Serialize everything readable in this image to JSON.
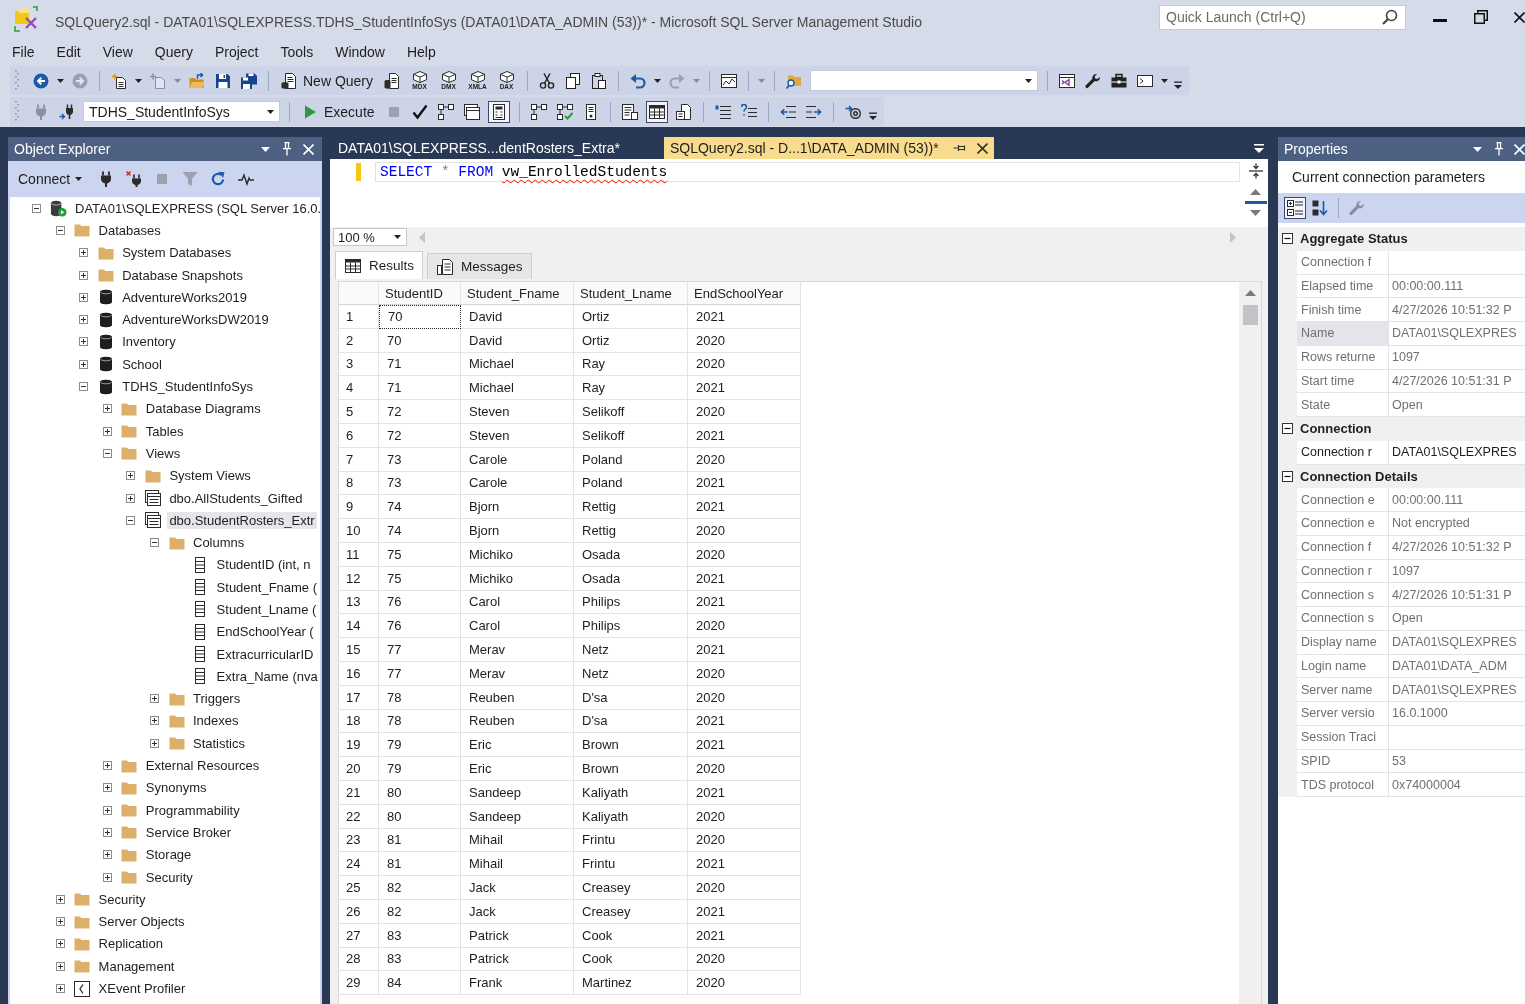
{
  "window": {
    "title": "SQLQuery2.sql - DATA01\\SQLEXPRESS.TDHS_StudentInfoSys (DATA01\\DATA_ADMIN (53))* - Microsoft SQL Server Management Studio",
    "quick_launch": {
      "placeholder": "Quick Launch (Ctrl+Q)"
    }
  },
  "menu": [
    "File",
    "Edit",
    "View",
    "Query",
    "Project",
    "Tools",
    "Window",
    "Help"
  ],
  "toolbars": [
    {
      "items": [
        {
          "kind": "grip"
        },
        {
          "kind": "icon",
          "disabled": false,
          "pressed": false
        },
        {
          "kind": "caret",
          "disabled": false
        },
        {
          "kind": "icon",
          "disabled": true,
          "pressed": false
        },
        {
          "kind": "separator"
        },
        {
          "kind": "icon",
          "disabled": false,
          "pressed": false
        },
        {
          "kind": "caret",
          "disabled": false
        },
        {
          "kind": "icon",
          "disabled": true,
          "pressed": false
        },
        {
          "kind": "caret",
          "disabled": true
        },
        {
          "kind": "icon",
          "disabled": false,
          "pressed": false
        },
        {
          "kind": "icon",
          "disabled": false,
          "pressed": false
        },
        {
          "kind": "icon",
          "disabled": false,
          "pressed": false
        },
        {
          "kind": "separator"
        },
        {
          "kind": "labeled",
          "label": "New Query",
          "disabled": false
        },
        {
          "kind": "icon",
          "disabled": false,
          "pressed": false
        },
        {
          "kind": "cube",
          "label": "MDX"
        },
        {
          "kind": "cube",
          "label": "DMX"
        },
        {
          "kind": "cube",
          "label": "XMLA"
        },
        {
          "kind": "cube",
          "label": "DAX"
        },
        {
          "kind": "separator"
        },
        {
          "kind": "icon",
          "disabled": false,
          "pressed": false
        },
        {
          "kind": "icon",
          "disabled": false,
          "pressed": false
        },
        {
          "kind": "icon",
          "disabled": false,
          "pressed": false
        },
        {
          "kind": "separator"
        },
        {
          "kind": "icon",
          "disabled": false,
          "pressed": false
        },
        {
          "kind": "caret",
          "disabled": false
        },
        {
          "kind": "icon",
          "disabled": true,
          "pressed": false
        },
        {
          "kind": "caret",
          "disabled": true
        },
        {
          "kind": "separator"
        },
        {
          "kind": "icon",
          "disabled": false,
          "pressed": false
        },
        {
          "kind": "separator"
        },
        {
          "kind": "caret",
          "disabled": true
        },
        {
          "kind": "separator"
        },
        {
          "kind": "icon",
          "disabled": false,
          "pressed": false
        },
        {
          "kind": "combo"
        },
        {
          "kind": "separator"
        },
        {
          "kind": "icon",
          "disabled": false,
          "pressed": false
        },
        {
          "kind": "icon",
          "disabled": false,
          "pressed": false
        },
        {
          "kind": "icon",
          "disabled": false,
          "pressed": false
        },
        {
          "kind": "icon",
          "disabled": false,
          "pressed": false
        },
        {
          "kind": "caret",
          "disabled": false
        },
        {
          "kind": "overflow"
        }
      ]
    },
    {
      "items": [
        {
          "kind": "grip"
        },
        {
          "kind": "icon",
          "disabled": true,
          "pressed": false
        },
        {
          "kind": "icon",
          "disabled": false,
          "pressed": false
        },
        {
          "kind": "combo",
          "value": "TDHS_StudentInfoSys"
        },
        {
          "kind": "separator"
        },
        {
          "kind": "labeled",
          "label": "Execute",
          "disabled": false
        },
        {
          "kind": "icon",
          "disabled": true,
          "pressed": false
        },
        {
          "kind": "icon",
          "disabled": false,
          "pressed": false
        },
        {
          "kind": "icon",
          "disabled": false,
          "pressed": false
        },
        {
          "kind": "icon",
          "disabled": false,
          "pressed": false
        },
        {
          "kind": "icon",
          "disabled": false,
          "pressed": true
        },
        {
          "kind": "separator"
        },
        {
          "kind": "icon",
          "disabled": false,
          "pressed": false
        },
        {
          "kind": "icon",
          "disabled": false,
          "pressed": false
        },
        {
          "kind": "icon",
          "disabled": false,
          "pressed": false
        },
        {
          "kind": "separator"
        },
        {
          "kind": "icon",
          "disabled": false,
          "pressed": false
        },
        {
          "kind": "icon",
          "disabled": false,
          "pressed": true
        },
        {
          "kind": "icon",
          "disabled": false,
          "pressed": false
        },
        {
          "kind": "separator"
        },
        {
          "kind": "icon",
          "disabled": false,
          "pressed": false
        },
        {
          "kind": "icon",
          "disabled": false,
          "pressed": false
        },
        {
          "kind": "separator"
        },
        {
          "kind": "icon",
          "disabled": false,
          "pressed": false
        },
        {
          "kind": "icon",
          "disabled": false,
          "pressed": false
        },
        {
          "kind": "separator"
        },
        {
          "kind": "icon",
          "disabled": false,
          "pressed": false
        },
        {
          "kind": "overflow"
        }
      ]
    }
  ],
  "object_explorer": {
    "title": "Object Explorer",
    "toolbar": [
      {
        "kind": "dropdown",
        "label": "Connect"
      },
      {
        "kind": "icon",
        "disabled": false,
        "pressed": false
      },
      {
        "kind": "icon",
        "disabled": false,
        "pressed": false
      },
      {
        "kind": "icon",
        "disabled": true,
        "pressed": false
      },
      {
        "kind": "icon",
        "disabled": true,
        "pressed": false
      },
      {
        "kind": "icon",
        "disabled": false,
        "pressed": false
      },
      {
        "kind": "icon",
        "disabled": false,
        "pressed": false
      }
    ],
    "tree": [
      {
        "label": "DATA01\\SQLEXPRESS (SQL Server 16.0.",
        "kind": "server",
        "expanded": true,
        "selected": false,
        "children": [
          {
            "label": "Databases",
            "kind": "folder",
            "expanded": true,
            "selected": false,
            "children": [
              {
                "label": "System Databases",
                "kind": "folder",
                "expanded": false,
                "selected": false
              },
              {
                "label": "Database Snapshots",
                "kind": "folder",
                "expanded": false,
                "selected": false
              },
              {
                "label": "AdventureWorks2019",
                "kind": "database",
                "expanded": false,
                "selected": false
              },
              {
                "label": "AdventureWorksDW2019",
                "kind": "database",
                "expanded": false,
                "selected": false
              },
              {
                "label": "Inventory",
                "kind": "database",
                "expanded": false,
                "selected": false
              },
              {
                "label": "School",
                "kind": "database",
                "expanded": false,
                "selected": false
              },
              {
                "label": "TDHS_StudentInfoSys",
                "kind": "database",
                "expanded": true,
                "selected": false,
                "children": [
                  {
                    "label": "Database Diagrams",
                    "kind": "folder",
                    "expanded": false,
                    "selected": false
                  },
                  {
                    "label": "Tables",
                    "kind": "folder",
                    "expanded": false,
                    "selected": false
                  },
                  {
                    "label": "Views",
                    "kind": "folder",
                    "expanded": true,
                    "selected": false,
                    "children": [
                      {
                        "label": "System Views",
                        "kind": "folder",
                        "expanded": false,
                        "selected": false
                      },
                      {
                        "label": "dbo.AllStudents_Gifted",
                        "kind": "view",
                        "expanded": false,
                        "selected": false
                      },
                      {
                        "label": "dbo.StudentRosters_Extr",
                        "kind": "view",
                        "expanded": true,
                        "selected": true,
                        "children": [
                          {
                            "label": "Columns",
                            "kind": "folder",
                            "expanded": true,
                            "selected": false,
                            "children": [
                              {
                                "label": "StudentID (int, n",
                                "kind": "column",
                                "selected": false
                              },
                              {
                                "label": "Student_Fname (",
                                "kind": "column",
                                "selected": false
                              },
                              {
                                "label": "Student_Lname (",
                                "kind": "column",
                                "selected": false
                              },
                              {
                                "label": "EndSchoolYear (",
                                "kind": "column",
                                "selected": false
                              },
                              {
                                "label": "ExtracurricularID",
                                "kind": "column",
                                "selected": false
                              },
                              {
                                "label": "Extra_Name (nva",
                                "kind": "column",
                                "selected": false
                              }
                            ]
                          },
                          {
                            "label": "Triggers",
                            "kind": "folder",
                            "expanded": false,
                            "selected": false
                          },
                          {
                            "label": "Indexes",
                            "kind": "folder",
                            "expanded": false,
                            "selected": false
                          },
                          {
                            "label": "Statistics",
                            "kind": "folder",
                            "expanded": false,
                            "selected": false
                          }
                        ]
                      }
                    ]
                  },
                  {
                    "label": "External Resources",
                    "kind": "folder",
                    "expanded": false,
                    "selected": false
                  },
                  {
                    "label": "Synonyms",
                    "kind": "folder",
                    "expanded": false,
                    "selected": false
                  },
                  {
                    "label": "Programmability",
                    "kind": "folder",
                    "expanded": false,
                    "selected": false
                  },
                  {
                    "label": "Service Broker",
                    "kind": "folder",
                    "expanded": false,
                    "selected": false
                  },
                  {
                    "label": "Storage",
                    "kind": "folder",
                    "expanded": false,
                    "selected": false
                  },
                  {
                    "label": "Security",
                    "kind": "folder",
                    "expanded": false,
                    "selected": false
                  }
                ]
              }
            ]
          },
          {
            "label": "Security",
            "kind": "folder",
            "expanded": false,
            "selected": false
          },
          {
            "label": "Server Objects",
            "kind": "folder",
            "expanded": false,
            "selected": false
          },
          {
            "label": "Replication",
            "kind": "folder",
            "expanded": false,
            "selected": false
          },
          {
            "label": "Management",
            "kind": "folder",
            "expanded": false,
            "selected": false
          },
          {
            "label": "XEvent Profiler",
            "kind": "profiler",
            "expanded": false,
            "selected": false
          }
        ]
      }
    ]
  },
  "editor": {
    "tabs": [
      {
        "label": "DATA01\\SQLEXPRESS...dentRosters_Extra*",
        "selected": false
      },
      {
        "label": "SQLQuery2.sql - D...1\\DATA_ADMIN (53))*",
        "selected": true
      }
    ],
    "code_lines": [
      [
        {
          "kind": "keyword",
          "text": "SELECT",
          "error": false
        },
        {
          "kind": "operator",
          "text": "*",
          "error": false
        },
        {
          "kind": "keyword",
          "text": "FROM",
          "error": false
        },
        {
          "kind": "identifier",
          "text": "vw_EnrolledStudents",
          "error": true
        }
      ]
    ],
    "zoom": "100 %"
  },
  "results": {
    "tabs": [
      {
        "label": "Results",
        "selected": true
      },
      {
        "label": "Messages",
        "selected": false
      }
    ],
    "columns": [
      "StudentID",
      "Student_Fname",
      "Student_Lname",
      "EndSchoolYear"
    ],
    "rows": [
      {
        "number": "1",
        "cells": [
          "70",
          "David",
          "Ortiz",
          "2021"
        ],
        "focused": true
      },
      {
        "number": "2",
        "cells": [
          "70",
          "David",
          "Ortiz",
          "2020"
        ],
        "focused": false
      },
      {
        "number": "3",
        "cells": [
          "71",
          "Michael",
          "Ray",
          "2020"
        ],
        "focused": false
      },
      {
        "number": "4",
        "cells": [
          "71",
          "Michael",
          "Ray",
          "2021"
        ],
        "focused": false
      },
      {
        "number": "5",
        "cells": [
          "72",
          "Steven",
          "Selikoff",
          "2020"
        ],
        "focused": false
      },
      {
        "number": "6",
        "cells": [
          "72",
          "Steven",
          "Selikoff",
          "2021"
        ],
        "focused": false
      },
      {
        "number": "7",
        "cells": [
          "73",
          "Carole",
          "Poland",
          "2020"
        ],
        "focused": false
      },
      {
        "number": "8",
        "cells": [
          "73",
          "Carole",
          "Poland",
          "2021"
        ],
        "focused": false
      },
      {
        "number": "9",
        "cells": [
          "74",
          "Bjorn",
          "Rettig",
          "2021"
        ],
        "focused": false
      },
      {
        "number": "10",
        "cells": [
          "74",
          "Bjorn",
          "Rettig",
          "2020"
        ],
        "focused": false
      },
      {
        "number": "11",
        "cells": [
          "75",
          "Michiko",
          "Osada",
          "2020"
        ],
        "focused": false
      },
      {
        "number": "12",
        "cells": [
          "75",
          "Michiko",
          "Osada",
          "2021"
        ],
        "focused": false
      },
      {
        "number": "13",
        "cells": [
          "76",
          "Carol",
          "Philips",
          "2021"
        ],
        "focused": false
      },
      {
        "number": "14",
        "cells": [
          "76",
          "Carol",
          "Philips",
          "2020"
        ],
        "focused": false
      },
      {
        "number": "15",
        "cells": [
          "77",
          "Merav",
          "Netz",
          "2021"
        ],
        "focused": false
      },
      {
        "number": "16",
        "cells": [
          "77",
          "Merav",
          "Netz",
          "2020"
        ],
        "focused": false
      },
      {
        "number": "17",
        "cells": [
          "78",
          "Reuben",
          "D'sa",
          "2020"
        ],
        "focused": false
      },
      {
        "number": "18",
        "cells": [
          "78",
          "Reuben",
          "D'sa",
          "2021"
        ],
        "focused": false
      },
      {
        "number": "19",
        "cells": [
          "79",
          "Eric",
          "Brown",
          "2021"
        ],
        "focused": false
      },
      {
        "number": "20",
        "cells": [
          "79",
          "Eric",
          "Brown",
          "2020"
        ],
        "focused": false
      },
      {
        "number": "21",
        "cells": [
          "80",
          "Sandeep",
          "Kaliyath",
          "2021"
        ],
        "focused": false
      },
      {
        "number": "22",
        "cells": [
          "80",
          "Sandeep",
          "Kaliyath",
          "2020"
        ],
        "focused": false
      },
      {
        "number": "23",
        "cells": [
          "81",
          "Mihail",
          "Frintu",
          "2020"
        ],
        "focused": false
      },
      {
        "number": "24",
        "cells": [
          "81",
          "Mihail",
          "Frintu",
          "2021"
        ],
        "focused": false
      },
      {
        "number": "25",
        "cells": [
          "82",
          "Jack",
          "Creasey",
          "2020"
        ],
        "focused": false
      },
      {
        "number": "26",
        "cells": [
          "82",
          "Jack",
          "Creasey",
          "2021"
        ],
        "focused": false
      },
      {
        "number": "27",
        "cells": [
          "83",
          "Patrick",
          "Cook",
          "2021"
        ],
        "focused": false
      },
      {
        "number": "28",
        "cells": [
          "83",
          "Patrick",
          "Cook",
          "2020"
        ],
        "focused": false
      },
      {
        "number": "29",
        "cells": [
          "84",
          "Frank",
          "Martinez",
          "2020"
        ],
        "focused": false
      }
    ]
  },
  "properties": {
    "title": "Properties",
    "object": "Current connection parameters",
    "toolbar": [
      {
        "kind": "icon",
        "disabled": false,
        "pressed": true
      },
      {
        "kind": "icon",
        "disabled": false,
        "pressed": false
      },
      {
        "kind": "separator"
      },
      {
        "kind": "icon",
        "disabled": true,
        "pressed": false
      }
    ],
    "categories": [
      {
        "name": "Aggregate Status",
        "expanded": true,
        "items": [
          {
            "name": "Connection f",
            "read_only": true,
            "selected": false
          },
          {
            "name": "Elapsed time",
            "value": "00:00:00.111",
            "read_only": true,
            "selected": false
          },
          {
            "name": "Finish time",
            "value": "4/27/2026 10:51:32 P",
            "read_only": true,
            "selected": false
          },
          {
            "name": "Name",
            "value": "DATA01\\SQLEXPRES",
            "read_only": true,
            "selected": true
          },
          {
            "name": "Rows returne",
            "value": "1097",
            "read_only": true,
            "selected": false
          },
          {
            "name": "Start time",
            "value": "4/27/2026 10:51:31 P",
            "read_only": true,
            "selected": false
          },
          {
            "name": "State",
            "value": "Open",
            "read_only": true,
            "selected": false
          }
        ]
      },
      {
        "name": "Connection",
        "expanded": true,
        "items": [
          {
            "name": "Connection r",
            "value": "DATA01\\SQLEXPRES",
            "read_only": false,
            "selected": false
          }
        ]
      },
      {
        "name": "Connection Details",
        "expanded": true,
        "items": [
          {
            "name": "Connection e",
            "value": "00:00:00.111",
            "read_only": true,
            "selected": false
          },
          {
            "name": "Connection e",
            "value": "Not encrypted",
            "read_only": true,
            "selected": false
          },
          {
            "name": "Connection f",
            "value": "4/27/2026 10:51:32 P",
            "read_only": true,
            "selected": false
          },
          {
            "name": "Connection r",
            "value": "1097",
            "read_only": true,
            "selected": false
          },
          {
            "name": "Connection s",
            "value": "4/27/2026 10:51:31 P",
            "read_only": true,
            "selected": false
          },
          {
            "name": "Connection s",
            "value": "Open",
            "read_only": true,
            "selected": false
          },
          {
            "name": "Display name",
            "value": "DATA01\\SQLEXPRES",
            "read_only": true,
            "selected": false
          },
          {
            "name": "Login name",
            "value": "DATA01\\DATA_ADM",
            "read_only": true,
            "selected": false
          },
          {
            "name": "Server name",
            "value": "DATA01\\SQLEXPRES",
            "read_only": true,
            "selected": false
          },
          {
            "name": "Server versio",
            "value": "16.0.1000",
            "read_only": true,
            "selected": false
          },
          {
            "name": "Session Traci",
            "read_only": true,
            "selected": false
          },
          {
            "name": "SPID",
            "value": "53",
            "read_only": true,
            "selected": false
          },
          {
            "name": "TDS protocol",
            "value": "0x74000004",
            "read_only": true,
            "selected": false
          }
        ]
      }
    ]
  }
}
